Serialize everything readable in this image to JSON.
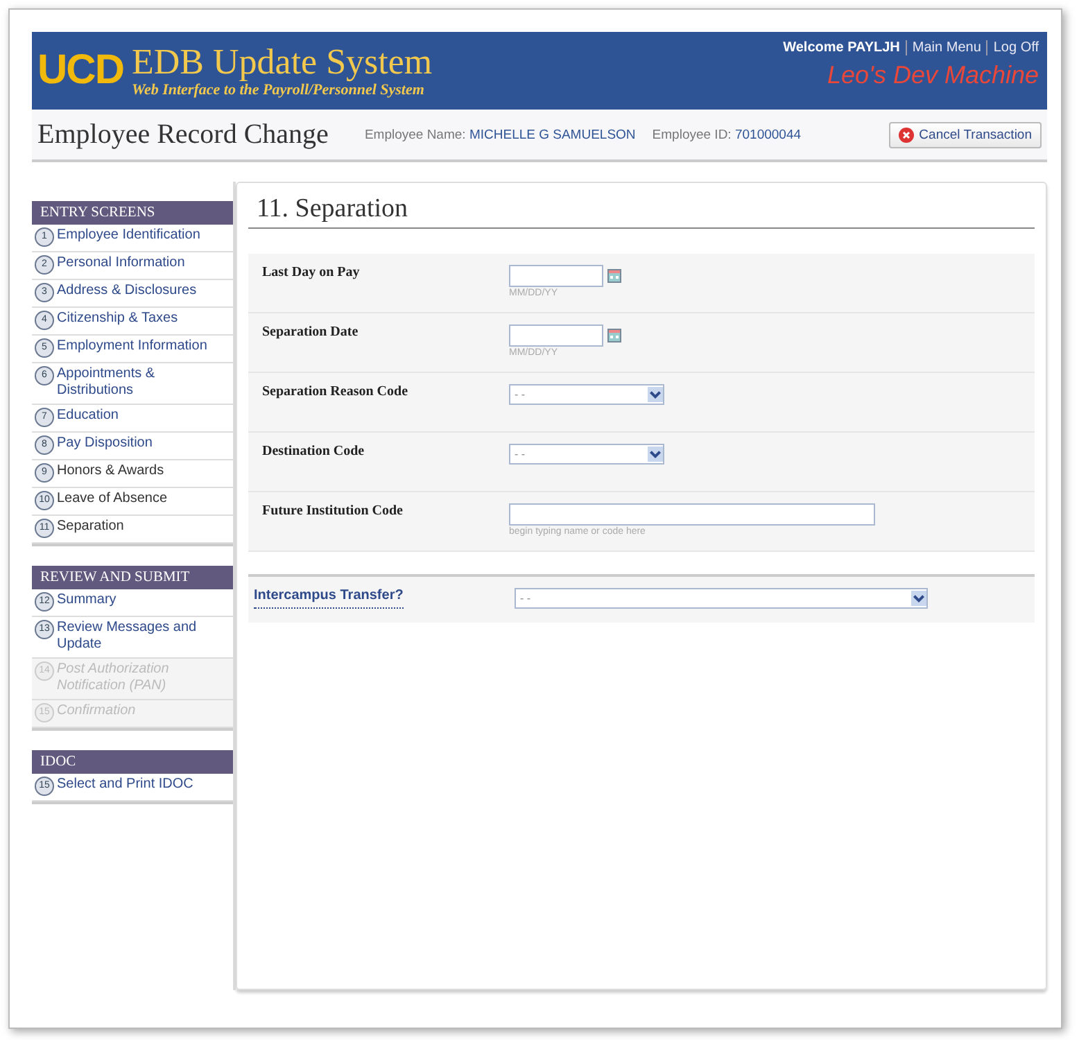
{
  "header": {
    "logo": "UCD",
    "title": "EDB Update System",
    "subtitle": "Web Interface to the Payroll/Personnel System",
    "welcome": "Welcome PAYLJH",
    "links": [
      "Main Menu",
      "Log Off"
    ],
    "machine": "Leo's Dev Machine"
  },
  "subheader": {
    "title": "Employee Record Change",
    "employee_name_label": "Employee Name:",
    "employee_name": "MICHELLE G SAMUELSON",
    "employee_id_label": "Employee ID:",
    "employee_id": "701000044",
    "cancel_button": "Cancel Transaction"
  },
  "sidebar": [
    {
      "heading": "ENTRY SCREENS",
      "items": [
        {
          "number": "1",
          "label": "Employee Identification",
          "kind": "link"
        },
        {
          "number": "2",
          "label": "Personal Information",
          "kind": "link"
        },
        {
          "number": "3",
          "label": "Address & Disclosures",
          "kind": "link"
        },
        {
          "number": "4",
          "label": "Citizenship & Taxes",
          "kind": "link"
        },
        {
          "number": "5",
          "label": "Employment Information",
          "kind": "link"
        },
        {
          "number": "6",
          "label": "Appointments & Distributions",
          "kind": "link"
        },
        {
          "number": "7",
          "label": "Education",
          "kind": "link"
        },
        {
          "number": "8",
          "label": "Pay Disposition",
          "kind": "link"
        },
        {
          "number": "9",
          "label": "Honors & Awards",
          "kind": "plain"
        },
        {
          "number": "10",
          "label": "Leave of Absence",
          "kind": "plain"
        },
        {
          "number": "11",
          "label": "Separation",
          "kind": "plain"
        }
      ]
    },
    {
      "heading": "REVIEW AND SUBMIT",
      "items": [
        {
          "number": "12",
          "label": "Summary",
          "kind": "link"
        },
        {
          "number": "13",
          "label": "Review Messages and Update",
          "kind": "link"
        },
        {
          "number": "14",
          "label": "Post Authorization Notification (PAN)",
          "kind": "disabled"
        },
        {
          "number": "15",
          "label": "Confirmation",
          "kind": "disabled"
        }
      ]
    },
    {
      "heading": "IDOC",
      "items": [
        {
          "number": "15",
          "label": "Select and Print IDOC",
          "kind": "link"
        }
      ]
    }
  ],
  "form": {
    "title": "11. Separation",
    "rows": [
      {
        "label": "Last Day on Pay",
        "kind": "date",
        "hint": "MM/DD/YY"
      },
      {
        "label": "Separation Date",
        "kind": "date",
        "hint": "MM/DD/YY"
      },
      {
        "label": "Separation Reason Code",
        "kind": "select",
        "value": "- -"
      },
      {
        "label": "Destination Code",
        "kind": "select",
        "value": "- -"
      },
      {
        "label": "Future Institution Code",
        "kind": "text",
        "hint": "begin typing name or code here"
      }
    ],
    "transfer": {
      "label": "Intercampus Transfer?",
      "value": "- -"
    }
  }
}
